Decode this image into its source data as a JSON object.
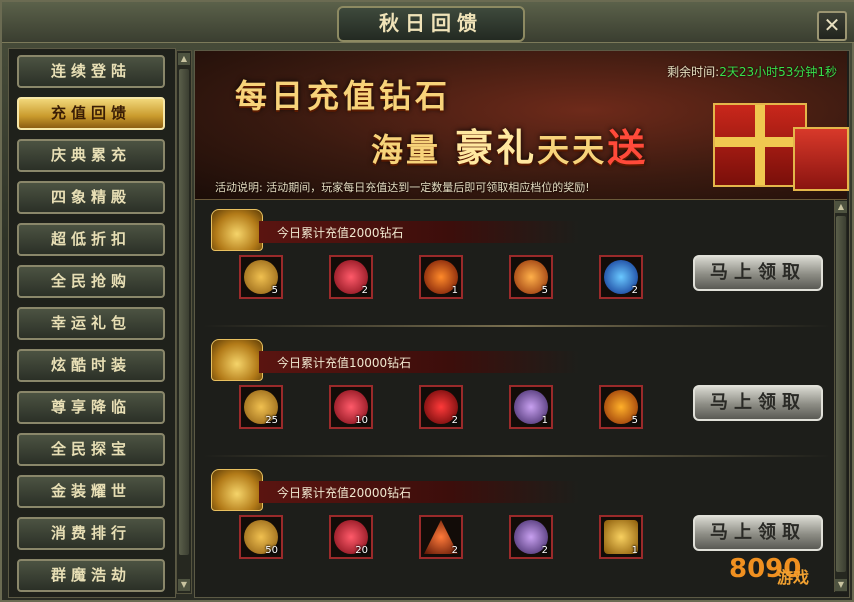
{
  "window": {
    "title": "秋日回馈",
    "close_glyph": "✕"
  },
  "sidebar": {
    "items": [
      {
        "label": "连续登陆",
        "active": false
      },
      {
        "label": "充值回馈",
        "active": true
      },
      {
        "label": "庆典累充",
        "active": false
      },
      {
        "label": "四象精殿",
        "active": false
      },
      {
        "label": "超低折扣",
        "active": false
      },
      {
        "label": "全民抢购",
        "active": false
      },
      {
        "label": "幸运礼包",
        "active": false
      },
      {
        "label": "炫酷时装",
        "active": false
      },
      {
        "label": "尊享降临",
        "active": false
      },
      {
        "label": "全民探宝",
        "active": false
      },
      {
        "label": "金装耀世",
        "active": false
      },
      {
        "label": "消费排行",
        "active": false
      },
      {
        "label": "群魔浩劫",
        "active": false
      }
    ]
  },
  "banner": {
    "headline_1": "每日充值钻石",
    "headline_2a": "海量",
    "headline_2b": "豪礼",
    "headline_2c": "天天",
    "headline_2d": "送",
    "countdown_label": "剩余时间:",
    "countdown_value": "2天23小时53分钟1秒",
    "description": "活动说明: 活动期间，玩家每日充值达到一定数量后即可领取相应档位的奖励!"
  },
  "rewards": [
    {
      "title": "今日累计充值2000钻石",
      "claim_label": "马上领取",
      "items": [
        {
          "icon": "golden-chest-icon",
          "count": "5",
          "color": "#c8901c"
        },
        {
          "icon": "ruby-ring-icon",
          "count": "2",
          "color": "#c8202c"
        },
        {
          "icon": "fire-orb-icon",
          "count": "1",
          "color": "#d04010"
        },
        {
          "icon": "phoenix-feather-icon",
          "count": "5",
          "color": "#e06a18"
        },
        {
          "icon": "blue-gem-icon",
          "count": "2",
          "color": "#1a6ad8"
        }
      ]
    },
    {
      "title": "今日累计充值10000钻石",
      "claim_label": "马上领取",
      "items": [
        {
          "icon": "golden-chest-icon",
          "count": "25",
          "color": "#c8901c"
        },
        {
          "icon": "ruby-ring-icon",
          "count": "10",
          "color": "#c8202c"
        },
        {
          "icon": "red-orb-icon",
          "count": "2",
          "color": "#c81a1a"
        },
        {
          "icon": "purple-chest-icon",
          "count": "1",
          "color": "#7a5aa8"
        },
        {
          "icon": "dragon-egg-icon",
          "count": "5",
          "color": "#d86a14"
        }
      ]
    },
    {
      "title": "今日累计充值20000钻石",
      "claim_label": "马上领取",
      "items": [
        {
          "icon": "golden-chest-icon",
          "count": "50",
          "color": "#c8901c"
        },
        {
          "icon": "ruby-ring-icon",
          "count": "20",
          "color": "#c8202c"
        },
        {
          "icon": "triangle-rune-icon",
          "count": "2",
          "color": "#d8401a"
        },
        {
          "icon": "purple-chest-icon",
          "count": "2",
          "color": "#7a5aa8"
        },
        {
          "icon": "golden-box-icon",
          "count": "1",
          "color": "#d8a01c"
        }
      ]
    }
  ],
  "watermark": {
    "main": "8090",
    "sub": "游戏"
  }
}
